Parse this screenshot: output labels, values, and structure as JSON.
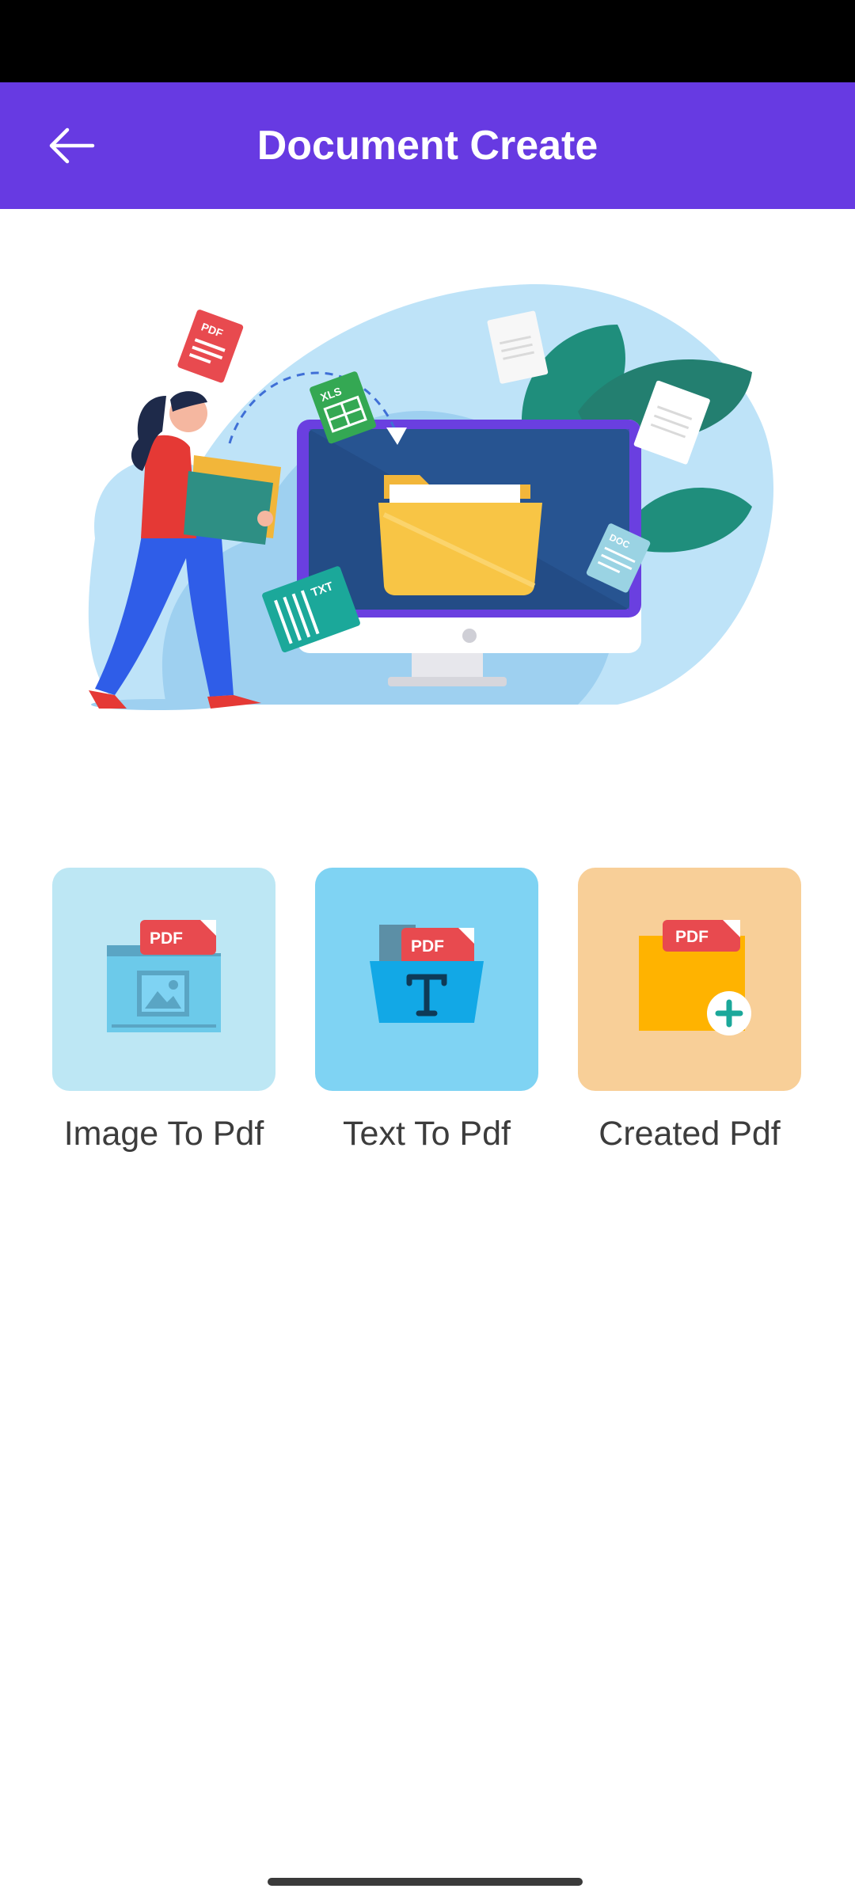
{
  "app_bar": {
    "title": "Document Create",
    "back_icon": "arrow-left-icon",
    "background": "#673AE2"
  },
  "hero": {
    "icon": "document-management-illustration",
    "file_tags": [
      "PDF",
      "XLS",
      "TXT",
      "DOC"
    ]
  },
  "tiles": [
    {
      "label": "Image To Pdf",
      "icon": "image-to-pdf-icon",
      "badge": "PDF",
      "background": "#BDE7F4"
    },
    {
      "label": "Text To Pdf",
      "icon": "text-to-pdf-icon",
      "badge": "PDF",
      "background": "#7FD3F3"
    },
    {
      "label": "Created Pdf",
      "icon": "created-pdf-folder-icon",
      "badge": "PDF",
      "background": "#F8CF98"
    }
  ],
  "colors": {
    "accent": "#673AE2",
    "pdf_red": "#E84A4F",
    "folder_yellow": "#FFB300",
    "teal": "#1BA89A"
  }
}
